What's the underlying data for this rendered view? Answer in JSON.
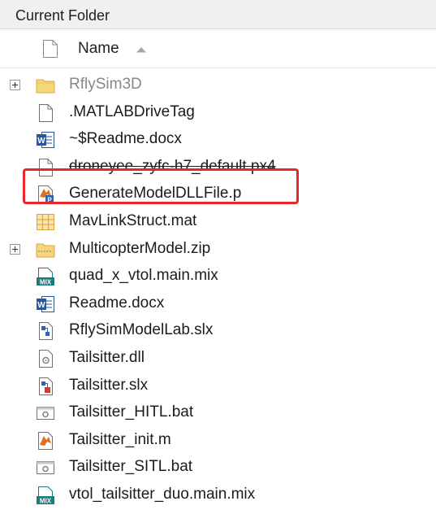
{
  "panel": {
    "title": "Current Folder"
  },
  "columns": {
    "name_label": "Name",
    "sort": "ascending"
  },
  "highlight_color": "#e8262c",
  "files": [
    {
      "name": "RflySim3D",
      "icon": "folder-icon",
      "expandable": true,
      "dimmed": true
    },
    {
      "name": ".MATLABDriveTag",
      "icon": "blank-file-icon"
    },
    {
      "name": "~$Readme.docx",
      "icon": "word-doc-icon"
    },
    {
      "name": "droneyee_zyfc-h7_default.px4",
      "icon": "blank-file-icon",
      "strikethrough": true
    },
    {
      "name": "GenerateModelDLLFile.p",
      "icon": "matlab-p-file-icon",
      "highlighted": true
    },
    {
      "name": "MavLinkStruct.mat",
      "icon": "mat-file-icon"
    },
    {
      "name": "MulticopterModel.zip",
      "icon": "zip-folder-icon",
      "expandable": true
    },
    {
      "name": "quad_x_vtol.main.mix",
      "icon": "mix-file-icon"
    },
    {
      "name": "Readme.docx",
      "icon": "word-doc-icon"
    },
    {
      "name": "RflySimModelLab.slx",
      "icon": "simulink-model-icon"
    },
    {
      "name": "Tailsitter.dll",
      "icon": "dll-file-icon"
    },
    {
      "name": "Tailsitter.slx",
      "icon": "simulink-model-red-icon"
    },
    {
      "name": "Tailsitter_HITL.bat",
      "icon": "bat-file-icon"
    },
    {
      "name": "Tailsitter_init.m",
      "icon": "matlab-script-icon"
    },
    {
      "name": "Tailsitter_SITL.bat",
      "icon": "bat-file-icon"
    },
    {
      "name": "vtol_tailsitter_duo.main.mix",
      "icon": "mix-file-icon"
    }
  ]
}
